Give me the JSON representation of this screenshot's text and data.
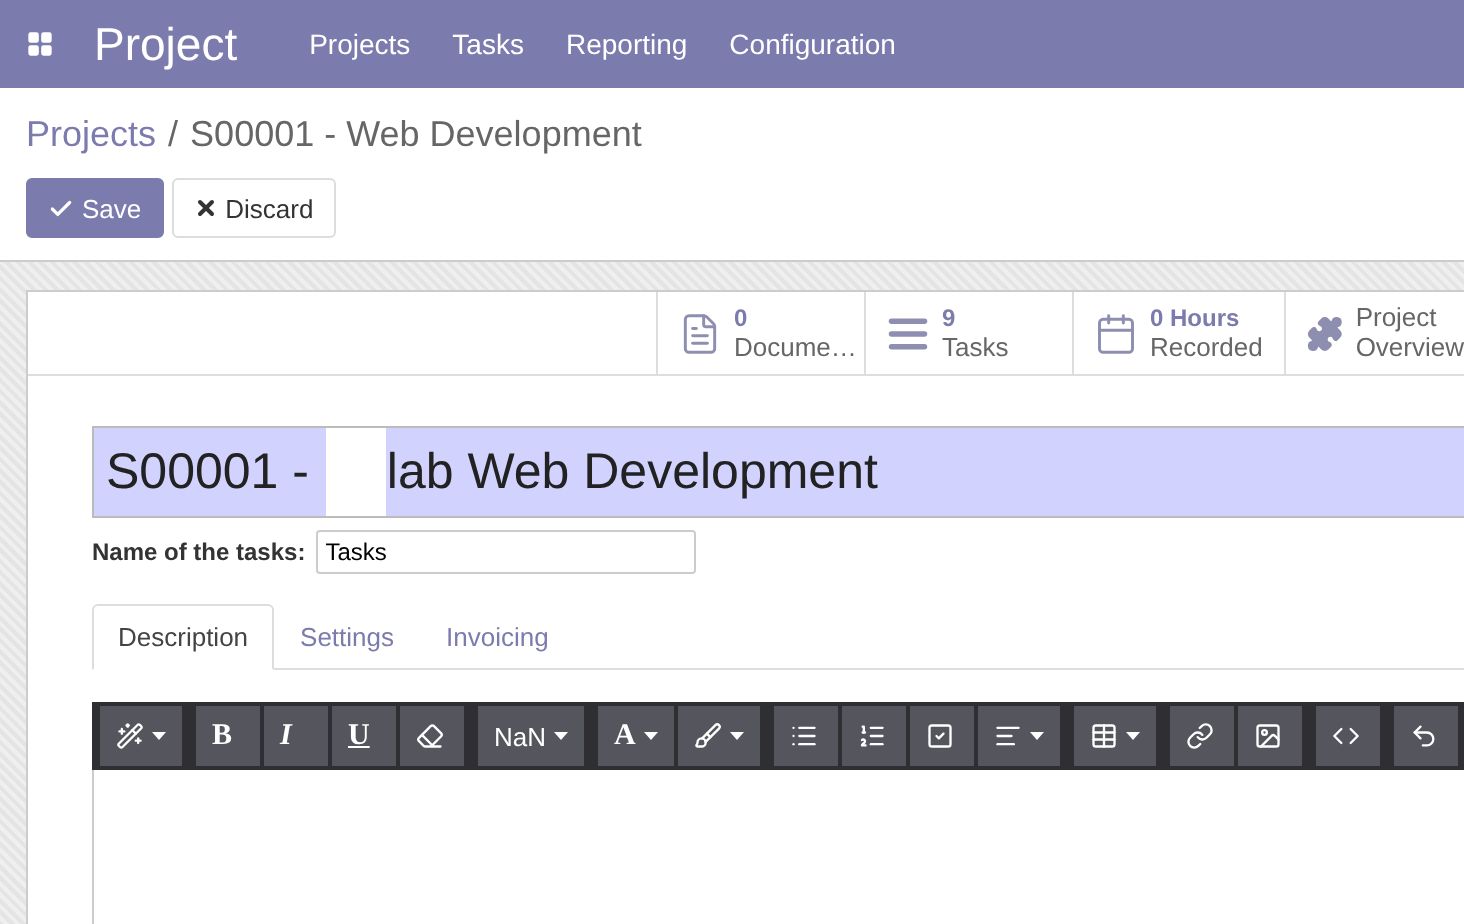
{
  "navbar": {
    "app_name": "Project",
    "menu": [
      "Projects",
      "Tasks",
      "Reporting",
      "Configuration"
    ]
  },
  "breadcrumb": {
    "parent": "Projects",
    "separator": "/",
    "current": "S00001 - Web Development"
  },
  "actions": [
    {
      "kind": "primary",
      "label": "Save"
    },
    {
      "kind": "secondary",
      "label": "Discard"
    }
  ],
  "stat_buttons": [
    {
      "kind": "document",
      "value": "0",
      "label": "Docume…"
    },
    {
      "kind": "tasks",
      "value": "9",
      "label": "Tasks"
    },
    {
      "kind": "calendar",
      "value": "0 Hours",
      "label": "Recorded"
    },
    {
      "kind": "puzzle",
      "value": "Project",
      "label": "Overview"
    }
  ],
  "title": {
    "before": "S00001 - ",
    "after": "lab Web Development",
    "redacted": true
  },
  "name_of_tasks": {
    "label": "Name of the tasks:",
    "value": "Tasks"
  },
  "tabs": [
    {
      "label": "Description",
      "selected": true
    },
    {
      "label": "Settings",
      "selected": false
    },
    {
      "label": "Invoicing",
      "selected": false
    }
  ],
  "editor_toolbar": [
    [
      {
        "kind": "magic",
        "caret": true
      }
    ],
    [
      {
        "kind": "bold",
        "text": "B"
      },
      {
        "kind": "italic",
        "text": "I"
      },
      {
        "kind": "underline",
        "text": "U"
      },
      {
        "kind": "eraser"
      }
    ],
    [
      {
        "kind": "text",
        "text": "NaN",
        "caret": true
      }
    ],
    [
      {
        "kind": "serif",
        "text": "A",
        "caret": true
      },
      {
        "kind": "brush",
        "caret": true
      }
    ],
    [
      {
        "kind": "list"
      },
      {
        "kind": "ordered"
      },
      {
        "kind": "check"
      },
      {
        "kind": "align",
        "caret": true
      }
    ],
    [
      {
        "kind": "table",
        "caret": true
      }
    ],
    [
      {
        "kind": "link"
      },
      {
        "kind": "image"
      }
    ],
    [
      {
        "kind": "code"
      }
    ],
    [
      {
        "kind": "undo"
      }
    ]
  ]
}
